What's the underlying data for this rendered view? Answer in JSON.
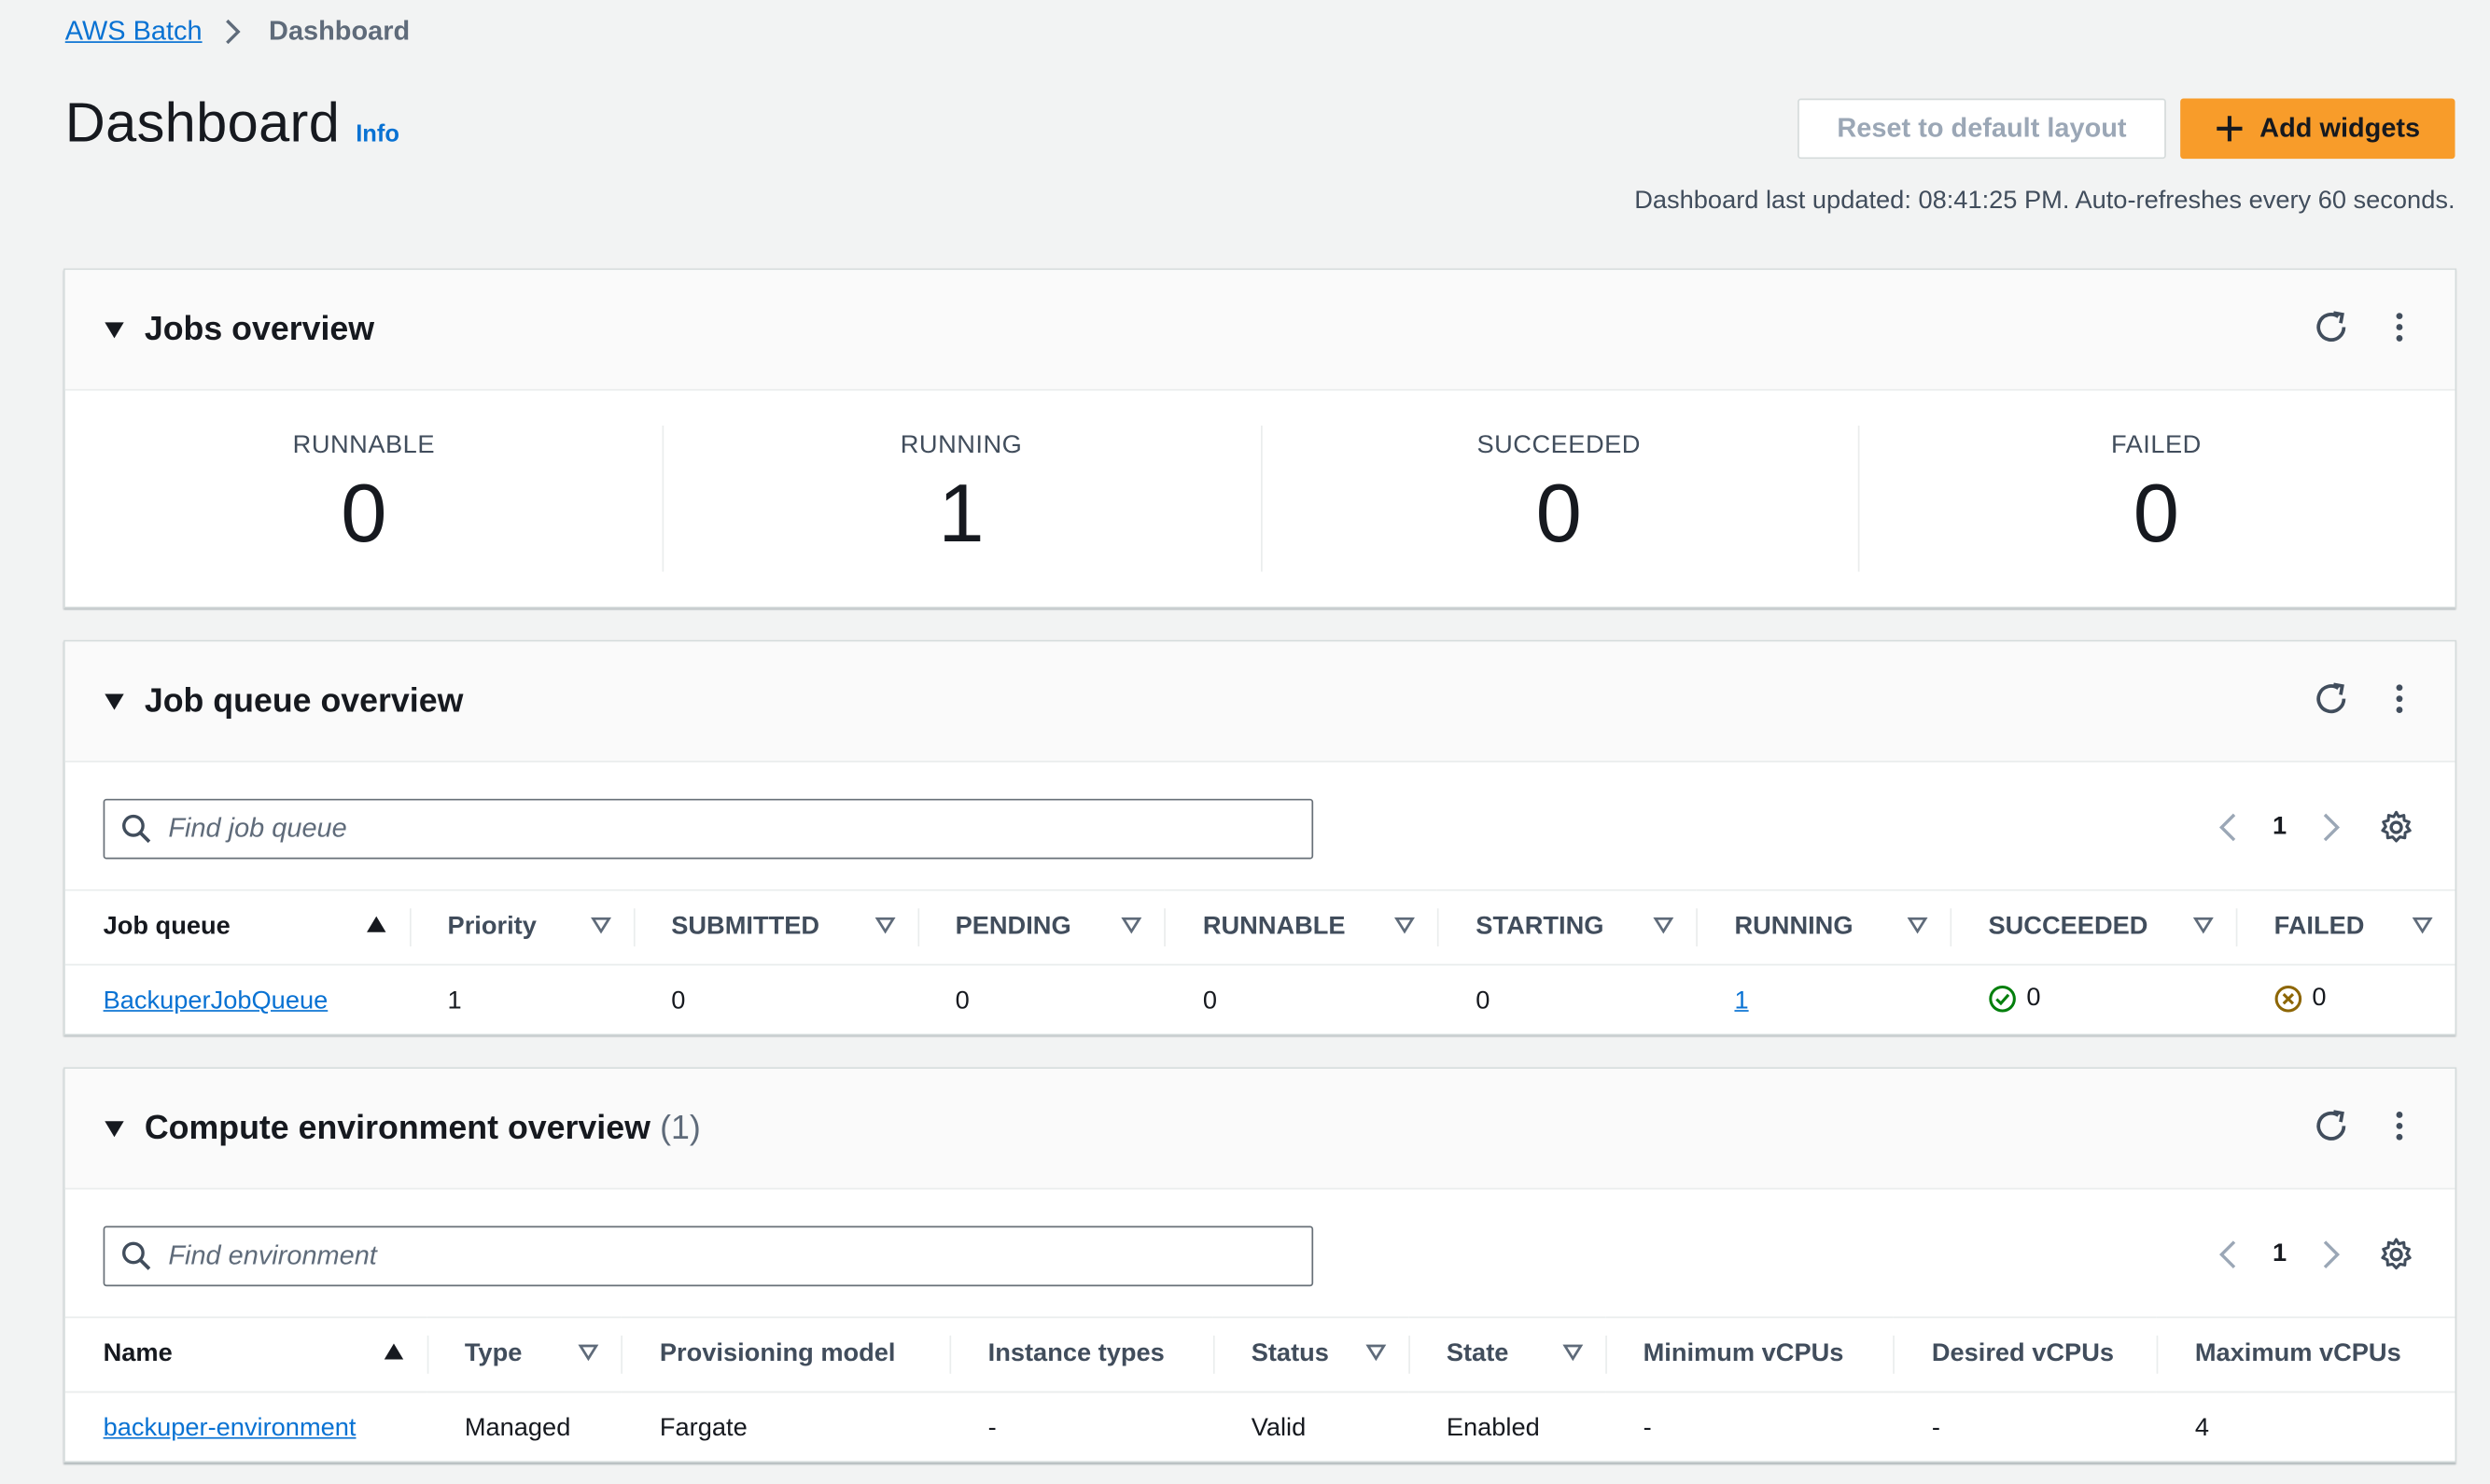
{
  "breadcrumb": {
    "root": "AWS Batch",
    "current": "Dashboard"
  },
  "page": {
    "title": "Dashboard",
    "info": "Info"
  },
  "buttons": {
    "reset": "Reset to default layout",
    "add": "Add widgets"
  },
  "status_line": "Dashboard last updated: 08:41:25 PM. Auto-refreshes every 60 seconds.",
  "jobs_overview": {
    "title": "Jobs overview",
    "metrics": [
      {
        "label": "RUNNABLE",
        "value": "0"
      },
      {
        "label": "RUNNING",
        "value": "1"
      },
      {
        "label": "SUCCEEDED",
        "value": "0"
      },
      {
        "label": "FAILED",
        "value": "0"
      }
    ]
  },
  "job_queue_overview": {
    "title": "Job queue overview",
    "search_placeholder": "Find job queue",
    "page": "1",
    "columns": [
      "Job queue",
      "Priority",
      "SUBMITTED",
      "PENDING",
      "RUNNABLE",
      "STARTING",
      "RUNNING",
      "SUCCEEDED",
      "FAILED"
    ],
    "rows": [
      {
        "name": "BackuperJobQueue",
        "priority": "1",
        "submitted": "0",
        "pending": "0",
        "runnable": "0",
        "starting": "0",
        "running": "1",
        "succeeded": "0",
        "failed": "0"
      }
    ]
  },
  "compute_env_overview": {
    "title": "Compute environment overview",
    "count": "(1)",
    "search_placeholder": "Find environment",
    "page": "1",
    "columns": [
      "Name",
      "Type",
      "Provisioning model",
      "Instance types",
      "Status",
      "State",
      "Minimum vCPUs",
      "Desired vCPUs",
      "Maximum vCPUs"
    ],
    "rows": [
      {
        "name": "backuper-environment",
        "type": "Managed",
        "provisioning": "Fargate",
        "instance_types": "-",
        "status": "Valid",
        "state": "Enabled",
        "min": "-",
        "desired": "-",
        "max": "4"
      }
    ]
  },
  "colors": {
    "accent": "#f89c2a",
    "link": "#0972d3",
    "success": "#037f0c",
    "error": "#8d6605"
  }
}
